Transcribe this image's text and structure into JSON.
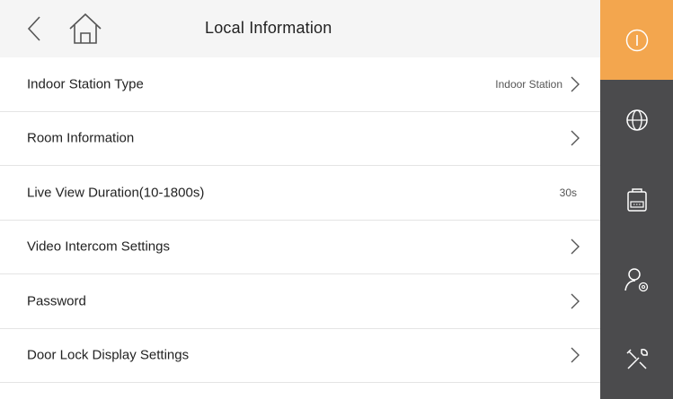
{
  "header": {
    "title": "Local Information",
    "back_icon": "chevron-left-icon",
    "home_icon": "home-icon",
    "background": "#f5f5f5"
  },
  "list": [
    {
      "label": "Indoor Station Type",
      "value": "Indoor Station",
      "chevron": true
    },
    {
      "label": "Room Information",
      "value": "",
      "chevron": true
    },
    {
      "label": "Live View Duration(10-1800s)",
      "value": "30s",
      "chevron": false
    },
    {
      "label": "Video Intercom Settings",
      "value": "",
      "chevron": true
    },
    {
      "label": "Password",
      "value": "",
      "chevron": true
    },
    {
      "label": "Door Lock Display Settings",
      "value": "",
      "chevron": true
    }
  ],
  "sidebar": {
    "background": "#4b4b4d",
    "accent": "#f3a64e",
    "items": [
      {
        "icon": "info-icon",
        "active": true
      },
      {
        "icon": "globe-icon",
        "active": false
      },
      {
        "icon": "device-icon",
        "active": false
      },
      {
        "icon": "user-settings-icon",
        "active": false
      },
      {
        "icon": "tools-icon",
        "active": false
      }
    ]
  }
}
